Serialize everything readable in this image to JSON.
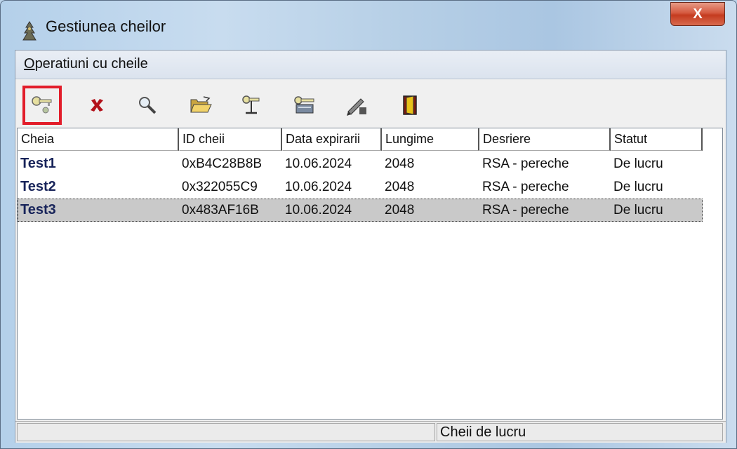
{
  "window": {
    "title": "Gestiunea cheilor",
    "close_label": "X"
  },
  "menu": {
    "items": [
      {
        "label_first": "O",
        "label_rest": "peratiuni cu cheile"
      }
    ]
  },
  "toolbar": {
    "buttons": [
      {
        "name": "new-key-button",
        "icon": "key-new-icon"
      },
      {
        "name": "delete-button",
        "icon": "delete-x-icon"
      },
      {
        "name": "search-button",
        "icon": "magnifier-icon"
      },
      {
        "name": "open-folder-button",
        "icon": "folder-open-icon"
      },
      {
        "name": "key-properties-button",
        "icon": "key-stand-icon"
      },
      {
        "name": "key-export-button",
        "icon": "key-card-icon"
      },
      {
        "name": "sign-button",
        "icon": "pen-sign-icon"
      },
      {
        "name": "exit-button",
        "icon": "exit-door-icon"
      }
    ],
    "highlight_color": "#e21d2a"
  },
  "table": {
    "columns": [
      "Cheia",
      "ID cheii",
      "Data expirarii",
      "Lungime",
      "Desriere",
      "Statut"
    ],
    "rows": [
      [
        "Test1",
        "0xB4C28B8B",
        "10.06.2024",
        "2048",
        "RSA - pereche",
        "De lucru"
      ],
      [
        "Test2",
        "0x322055C9",
        "10.06.2024",
        "2048",
        "RSA - pereche",
        "De lucru"
      ],
      [
        "Test3",
        "0x483AF16B",
        "10.06.2024",
        "2048",
        "RSA - pereche",
        "De lucru"
      ]
    ],
    "selected_row": 2
  },
  "status": {
    "left": "",
    "right": "Cheii de lucru"
  }
}
